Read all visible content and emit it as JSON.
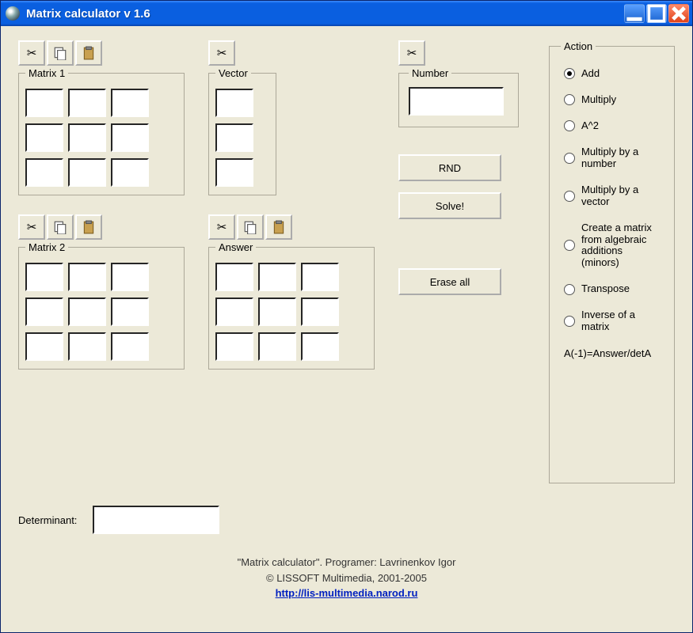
{
  "window": {
    "title": "Matrix calculator v 1.6"
  },
  "toolbar_icons": {
    "cut": "cut-icon",
    "copy": "copy-icon",
    "paste": "paste-icon"
  },
  "groups": {
    "matrix1": "Matrix 1",
    "matrix2": "Matrix 2",
    "vector": "Vector",
    "answer": "Answer",
    "number": "Number",
    "action": "Action"
  },
  "buttons": {
    "rnd": "RND",
    "solve": "Solve!",
    "erase_all": "Erase all"
  },
  "actions": {
    "items": [
      {
        "label": "Add",
        "selected": true
      },
      {
        "label": "Multiply",
        "selected": false
      },
      {
        "label": "A^2",
        "selected": false
      },
      {
        "label": "Multiply by a number",
        "selected": false
      },
      {
        "label": "Multiply by a vector",
        "selected": false
      },
      {
        "label": "Create a matrix from algebraic additions (minors)",
        "selected": false
      },
      {
        "label": "Transpose",
        "selected": false
      },
      {
        "label": "Inverse of a matrix",
        "selected": false
      }
    ],
    "formula": "A(-1)=Answer/detA"
  },
  "determinant": {
    "label": "Determinant:",
    "value": ""
  },
  "footer": {
    "line1": "\"Matrix calculator\".    Programer: Lavrinenkov Igor",
    "line2": "© LISSOFT Multimedia, 2001-2005",
    "link": "http://lis-multimedia.narod.ru"
  }
}
